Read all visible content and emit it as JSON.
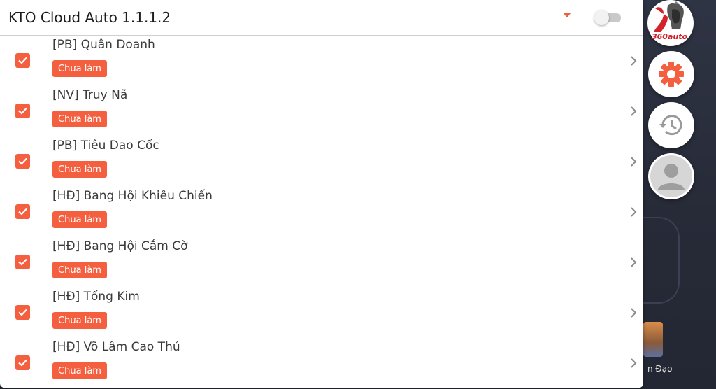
{
  "app": {
    "title": "KTO Cloud Auto 1.1.1.2",
    "toggle_on": false
  },
  "tasks": [
    {
      "name": "[PB] Quân Doanh",
      "status": "Chưa làm",
      "checked": true
    },
    {
      "name": "[NV] Truy Nã",
      "status": "Chưa làm",
      "checked": true
    },
    {
      "name": "[PB] Tiêu Dao Cốc",
      "status": "Chưa làm",
      "checked": true
    },
    {
      "name": "[HĐ] Bang Hội Khiêu Chiến",
      "status": "Chưa làm",
      "checked": true
    },
    {
      "name": "[HĐ] Bang Hội Cắm Cờ",
      "status": "Chưa làm",
      "checked": true
    },
    {
      "name": "[HĐ] Tống Kim",
      "status": "Chưa làm",
      "checked": true
    },
    {
      "name": "[HĐ] Võ Lâm Cao Thủ",
      "status": "Chưa làm",
      "checked": true
    }
  ],
  "side_buttons": {
    "logo_text": "360auto",
    "icons": [
      "warrior-logo-icon",
      "gear-icon",
      "history-icon",
      "user-icon"
    ]
  },
  "background": {
    "label": "n Đạo"
  },
  "colors": {
    "accent": "#f4603f",
    "toggle_track": "#c9c9c9"
  }
}
